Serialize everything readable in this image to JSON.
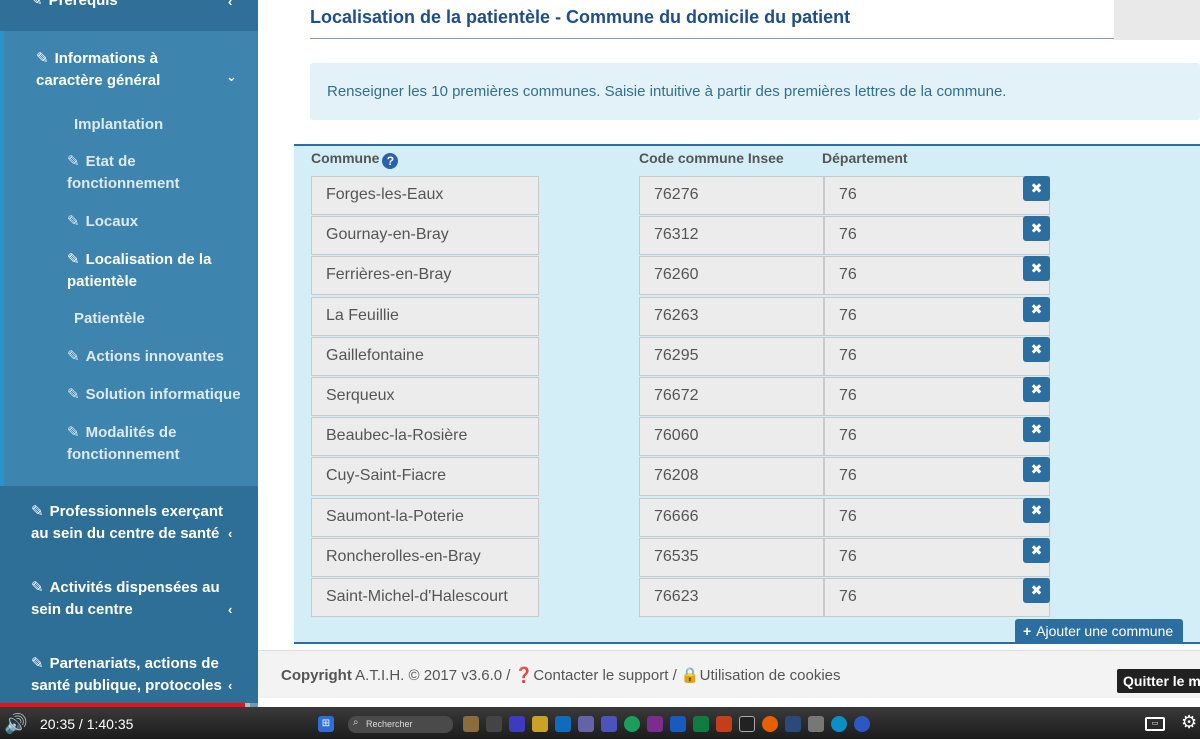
{
  "sidebar": {
    "top_item": {
      "label": "Prérequis"
    },
    "active_section": {
      "label_line1": "Informations à",
      "label_line2": "caractère général",
      "subitems": [
        {
          "line1": "Implantation",
          "line2": "",
          "icon": ""
        },
        {
          "line1": "Etat de",
          "line2": "fonctionnement",
          "icon": "edit-icon"
        },
        {
          "line1": "Locaux",
          "line2": "",
          "icon": "edit-icon"
        },
        {
          "line1": "Localisation de la",
          "line2": "patientèle",
          "icon": "edit-icon"
        },
        {
          "line1": "Patientèle",
          "line2": "",
          "icon": ""
        },
        {
          "line1": "Actions innovantes",
          "line2": "",
          "icon": "edit-icon"
        },
        {
          "line1": "Solution informatique",
          "line2": "",
          "icon": "edit-icon"
        },
        {
          "line1": "Modalités de",
          "line2": "fonctionnement",
          "icon": "edit-icon"
        }
      ]
    },
    "items": [
      {
        "line1": "Professionnels exerçant",
        "line2": "au sein du centre de santé"
      },
      {
        "line1": "Activités dispensées au",
        "line2": "sein du centre"
      },
      {
        "line1": "Partenariats, actions de",
        "line2": "santé publique, protocoles"
      }
    ]
  },
  "main": {
    "title": "Localisation de la patientèle - Commune du domicile du patient",
    "info": "Renseigner les 10 premières communes. Saisie intuitive à partir des premières lettres de la commune.",
    "columns": {
      "commune": "Commune",
      "insee": "Code commune Insee",
      "departement": "Département"
    },
    "rows": [
      {
        "commune": "Forges-les-Eaux",
        "insee": "76276",
        "dept": "76"
      },
      {
        "commune": "Gournay-en-Bray",
        "insee": "76312",
        "dept": "76"
      },
      {
        "commune": "Ferrières-en-Bray",
        "insee": "76260",
        "dept": "76"
      },
      {
        "commune": "La Feuillie",
        "insee": "76263",
        "dept": "76"
      },
      {
        "commune": "Gaillefontaine",
        "insee": "76295",
        "dept": "76"
      },
      {
        "commune": "Serqueux",
        "insee": "76672",
        "dept": "76"
      },
      {
        "commune": "Beaubec-la-Rosière",
        "insee": "76060",
        "dept": "76"
      },
      {
        "commune": "Cuy-Saint-Fiacre",
        "insee": "76208",
        "dept": "76"
      },
      {
        "commune": "Saumont-la-Poterie",
        "insee": "76666",
        "dept": "76"
      },
      {
        "commune": "Roncherolles-en-Bray",
        "insee": "76535",
        "dept": "76"
      },
      {
        "commune": "Saint-Michel-d'Halescourt",
        "insee": "76623",
        "dept": "76"
      }
    ],
    "add_button": "Ajouter une commune",
    "delete_symbol": "✖"
  },
  "footer": {
    "copyright_label": "Copyright",
    "copyright_text": "A.T.I.H. © 2017 v3.6.0 /",
    "support": "Contacter le support /",
    "cookies": "Utilisation de cookies"
  },
  "tooltip": {
    "quit": "Quitter le m"
  },
  "video": {
    "time": "20:35 / 1:40:35",
    "progress": 0.2045,
    "taskbar_search": "Rechercher",
    "accent": "#e5131c"
  }
}
